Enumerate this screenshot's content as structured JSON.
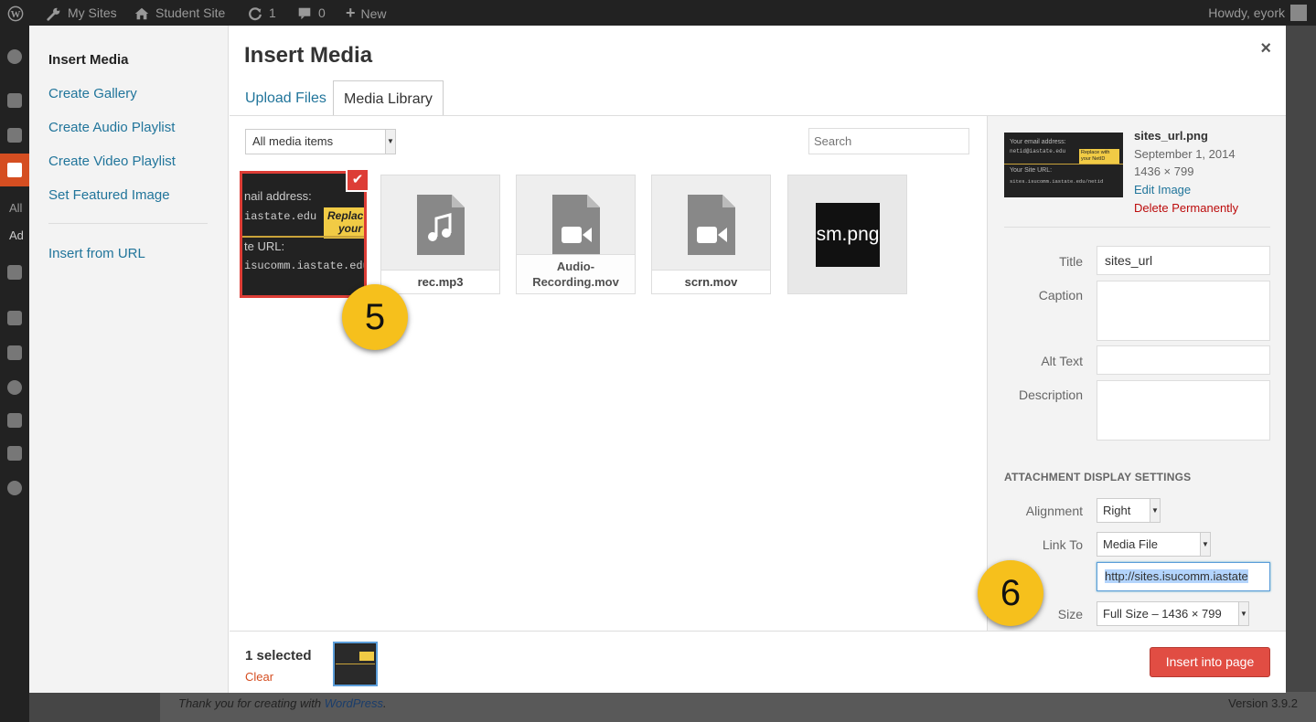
{
  "adminbar": {
    "my_sites": "My Sites",
    "site_name": "Student Site",
    "updates_count": "1",
    "comments_count": "0",
    "new_label": "New",
    "howdy": "Howdy, eyork"
  },
  "adminmenu": {
    "partial_all": "All",
    "partial_add": "Ad"
  },
  "footer": {
    "thanks_prefix": "Thank you for creating with ",
    "thanks_link": "WordPress",
    "thanks_suffix": ".",
    "version": "Version 3.9.2"
  },
  "modal": {
    "menu": {
      "items": [
        {
          "label": "Insert Media"
        },
        {
          "label": "Create Gallery"
        },
        {
          "label": "Create Audio Playlist"
        },
        {
          "label": "Create Video Playlist"
        },
        {
          "label": "Set Featured Image"
        },
        {
          "label": "Insert from URL"
        }
      ]
    },
    "title": "Insert Media",
    "close_symbol": "×",
    "tabs": [
      {
        "label": "Upload Files"
      },
      {
        "label": "Media Library"
      }
    ],
    "filter": {
      "selected": "All media items"
    },
    "search": {
      "placeholder": "Search"
    },
    "attachments": [
      {
        "filename": "sites_url.png",
        "type": "image",
        "selected": true
      },
      {
        "filename": "rec.mp3",
        "type": "audio"
      },
      {
        "filename": "Audio-Recording.mov",
        "display_lines": [
          "Audio-",
          "Recording.mov"
        ],
        "type": "video"
      },
      {
        "filename": "scrn.mov",
        "type": "video"
      },
      {
        "filename": "sm.png",
        "type": "image",
        "thumb_text": "sm.png"
      }
    ],
    "thumbnail_text": {
      "email_label": "nail address:",
      "email_value": "iastate.edu",
      "replace": "Replac",
      "replace2": "your",
      "url_label": "te URL:",
      "url_value": "isucomm.iastate.edu"
    },
    "sidebar_thumb_text": {
      "email_label": "Your email address:",
      "email_value": "netid@iastate.edu",
      "replace": "Replace with your NetID",
      "url_label": "Your Site URL:",
      "url_value": "sites.isucomm.iastate.edu/netid"
    },
    "details": {
      "filename": "sites_url.png",
      "date": "September 1, 2014",
      "dimensions": "1436 × 799",
      "edit_link": "Edit Image",
      "delete_link": "Delete Permanently"
    },
    "settings": {
      "title_label": "Title",
      "title_value": "sites_url",
      "caption_label": "Caption",
      "caption_value": "",
      "alt_label": "Alt Text",
      "alt_value": "",
      "description_label": "Description",
      "description_value": "",
      "display_heading": "Attachment Display Settings",
      "alignment_label": "Alignment",
      "alignment_value": "Right",
      "linkto_label": "Link To",
      "linkto_value": "Media File",
      "url_value": "http://sites.isucomm.iastate",
      "size_label": "Size",
      "size_value": "Full Size – 1436 × 799"
    },
    "toolbar": {
      "selected_count": "1 selected",
      "clear": "Clear",
      "insert_button": "Insert into page"
    },
    "callouts": [
      "5",
      "6"
    ]
  },
  "colors": {
    "link": "#21759b",
    "selected_border": "#dd3d36",
    "insert_button": "#e14d43",
    "callout": "#f6c01c",
    "delete": "#bc0b0b"
  }
}
